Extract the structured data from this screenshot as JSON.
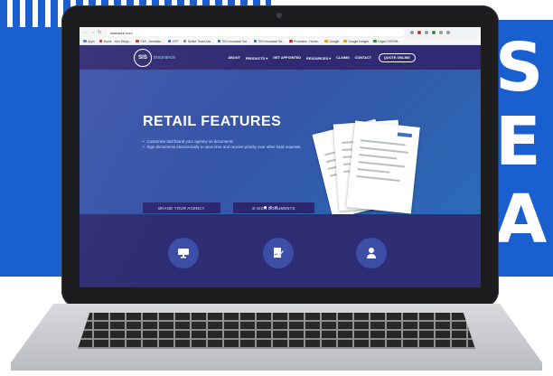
{
  "colors": {
    "background_blue": "#1a5fd0",
    "site_navy": "#2f2a72",
    "hero_blue": "#3555a8",
    "button_navy": "#2c2870",
    "feature_circle": "#3c4ea6"
  },
  "background": {
    "letters": [
      "S",
      "E",
      "A"
    ]
  },
  "browser": {
    "url": "sisinsure.com",
    "nav_icons": [
      "back-icon",
      "forward-icon",
      "reload-icon"
    ],
    "bookmarks": [
      {
        "label": "Apps",
        "color": "#4a7ad8"
      },
      {
        "label": "Home - Ken Stepp...",
        "color": "#c33"
      },
      {
        "label": "FAE - Armidale...",
        "color": "#c33"
      },
      {
        "label": "CFP",
        "color": "#3a6fc8"
      },
      {
        "label": "Settlor Team Ass...",
        "color": "#888"
      },
      {
        "label": "SIS Insurance Sol...",
        "color": "#3a6fc8"
      },
      {
        "label": "SIS Insurance Se...",
        "color": "#3a6fc8"
      },
      {
        "label": "Providers - Home...",
        "color": "#c33"
      },
      {
        "label": "Google",
        "color": "#e8a21a"
      },
      {
        "label": "Google Images",
        "color": "#e8a21a"
      },
      {
        "label": "Legal CHROM...",
        "color": "#2c8f3c"
      }
    ]
  },
  "site": {
    "logo_mark": "SIS",
    "logo_text": "insurance",
    "menu": [
      "ABOUT",
      "PRODUCTS ▾",
      "GET APPOINTED",
      "RESOURCES ▾",
      "CLAIMS",
      "CONTACT"
    ],
    "cta": "QUOTE ONLINE"
  },
  "hero": {
    "title": "RETAIL FEATURES",
    "bullets": [
      "Customize and brand your agency on documents",
      "Sign documents electronically to save time and receive priority over other bind requests"
    ],
    "buttons": [
      "BRAND YOUR AGENCY",
      "E-SIGN DOCUMENTS"
    ],
    "slider_count": 3
  },
  "features": {
    "icons": [
      "monitor-icon",
      "signature-document-icon",
      "agent-user-icon"
    ]
  }
}
